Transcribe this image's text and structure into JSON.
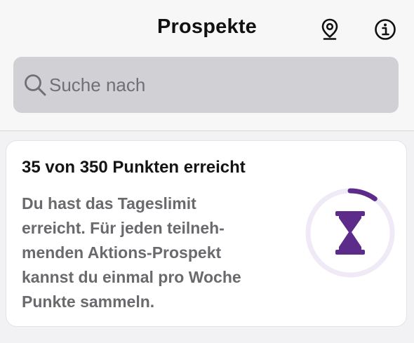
{
  "header": {
    "title": "Prospekte"
  },
  "search": {
    "placeholder": "Suche nach"
  },
  "points_card": {
    "title": "35 von 350 Punkten erreicht",
    "message_lines": [
      "Du hast das Tageslimit",
      "erreicht. Für jeden teilneh-",
      "menden Aktions-Prospekt",
      "kannst du einmal pro Woche",
      "Punkte sammeln."
    ],
    "progress": 0.1,
    "icon": "hourglass-icon"
  },
  "icons": {
    "location": "map-pin-icon",
    "info": "info-icon",
    "search": "search-icon"
  },
  "colors": {
    "accent": "#5d2b8a",
    "ring_track": "#efeaf6"
  }
}
